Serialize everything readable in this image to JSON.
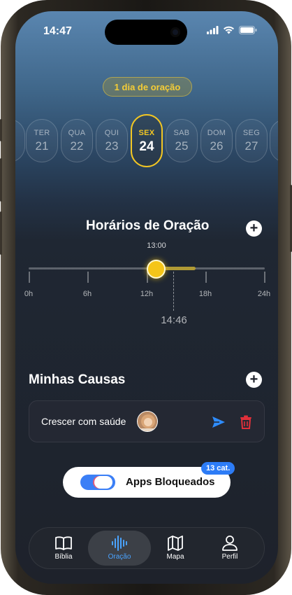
{
  "status_bar": {
    "time": "14:47"
  },
  "streak": {
    "label": "1 dia de oração"
  },
  "week_days": [
    {
      "name": "",
      "number": ""
    },
    {
      "name": "TER",
      "number": "21"
    },
    {
      "name": "QUA",
      "number": "22"
    },
    {
      "name": "QUI",
      "number": "23"
    },
    {
      "name": "SEX",
      "number": "24"
    },
    {
      "name": "SAB",
      "number": "25"
    },
    {
      "name": "DOM",
      "number": "26"
    },
    {
      "name": "SEG",
      "number": "27"
    },
    {
      "name": "",
      "number": ""
    }
  ],
  "prayer_times": {
    "title": "Horários de Oração",
    "selected_time": "13:00",
    "current_time": "14:46",
    "axis_labels": [
      "0h",
      "6h",
      "12h",
      "18h",
      "24h"
    ]
  },
  "causes": {
    "title": "Minhas Causas",
    "items": [
      {
        "text": "Crescer com saúde"
      }
    ]
  },
  "blocked_apps": {
    "label": "Apps Bloqueados",
    "badge": "13 cat.",
    "enabled": true
  },
  "tabs": [
    {
      "label": "Bíblia",
      "icon": "book-icon"
    },
    {
      "label": "Oração",
      "icon": "waveform-icon",
      "active": true
    },
    {
      "label": "Mapa",
      "icon": "map-icon"
    },
    {
      "label": "Perfil",
      "icon": "person-icon"
    }
  ],
  "colors": {
    "accent": "#f2c623",
    "blue": "#3b7ff6",
    "delete": "#e0303a"
  }
}
